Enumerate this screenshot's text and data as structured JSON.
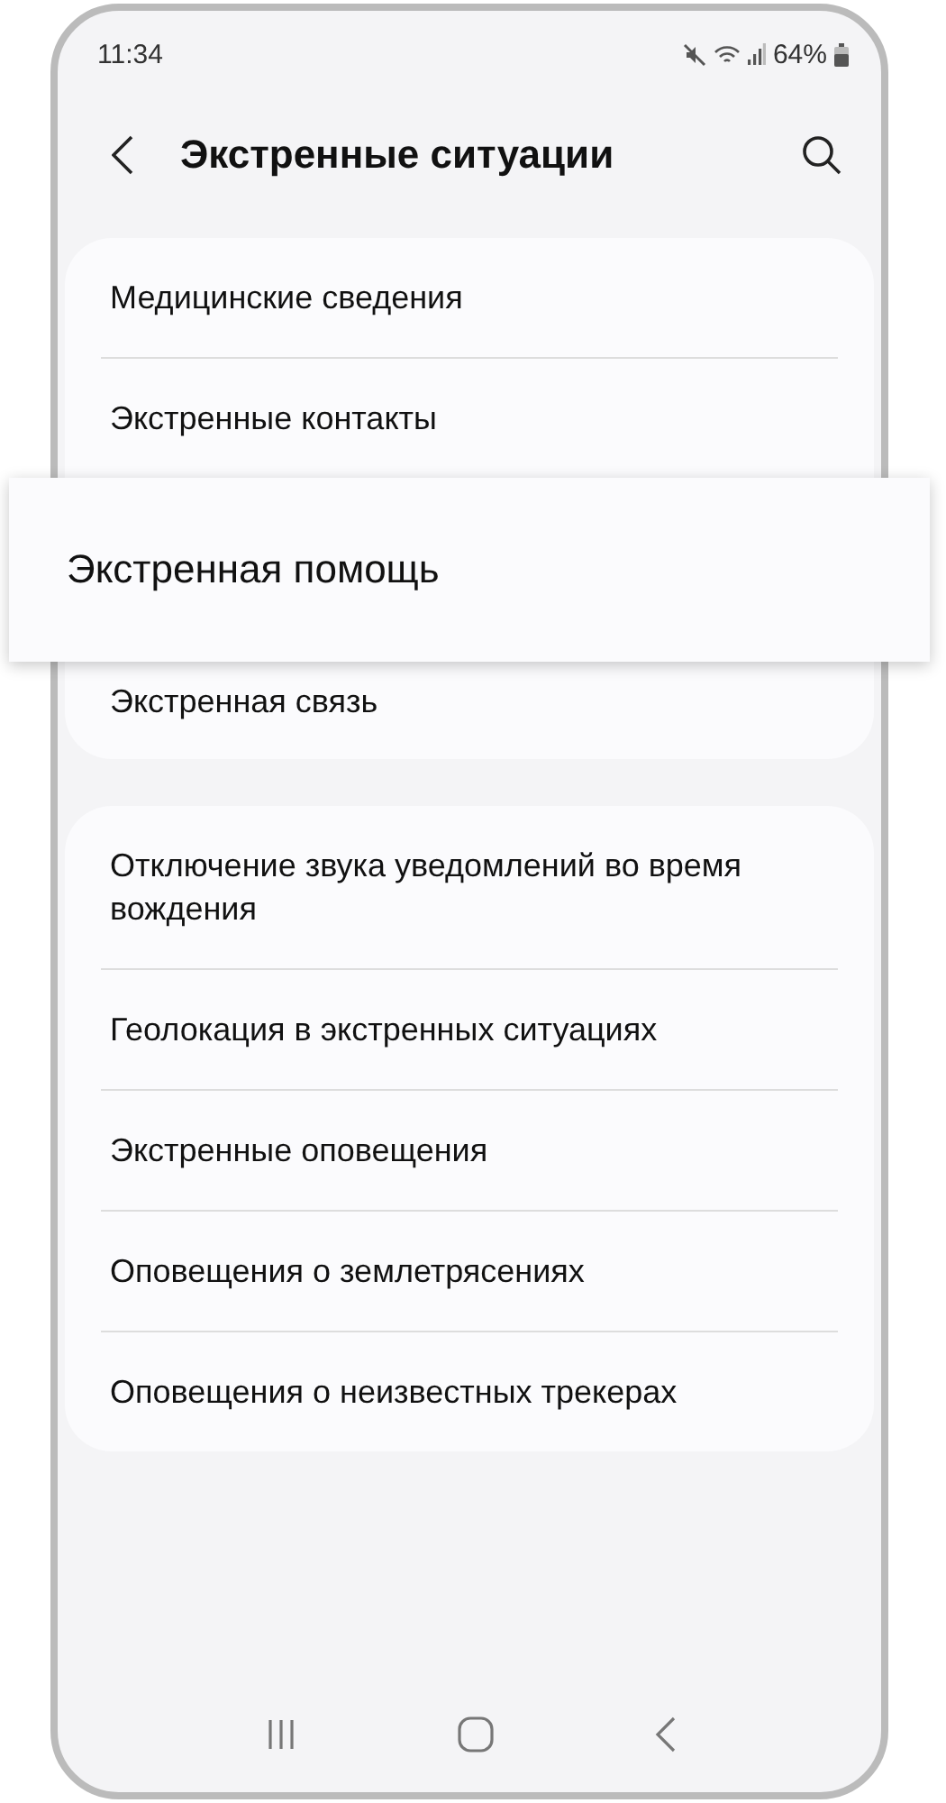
{
  "status_bar": {
    "time": "11:34",
    "battery": "64%"
  },
  "header": {
    "title": "Экстренные ситуации"
  },
  "groups": [
    {
      "items": [
        {
          "label": "Медицинские сведения",
          "highlighted": false
        },
        {
          "label": "Экстренные контакты",
          "highlighted": false
        },
        {
          "label": "Экстренная помощь",
          "highlighted": true
        },
        {
          "label": "Экстренная связь",
          "highlighted": false
        }
      ]
    },
    {
      "items": [
        {
          "label": "Отключение звука уведомлений во время вождения",
          "highlighted": false
        },
        {
          "label": "Геолокация в экстренных ситуациях",
          "highlighted": false
        },
        {
          "label": "Экстренные оповещения",
          "highlighted": false
        },
        {
          "label": "Оповещения о землетрясениях",
          "highlighted": false
        },
        {
          "label": "Оповещения о неизвестных трекерах",
          "highlighted": false
        }
      ]
    }
  ]
}
